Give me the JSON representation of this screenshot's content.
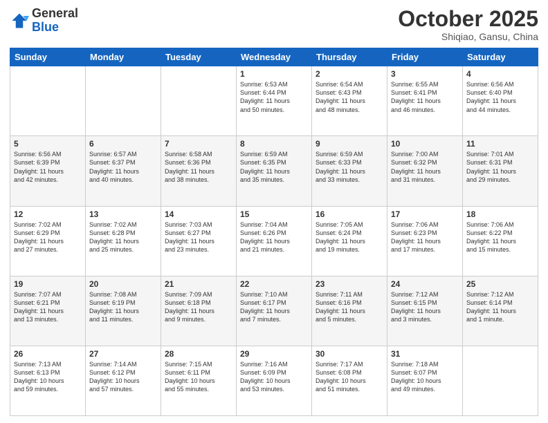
{
  "header": {
    "logo_general": "General",
    "logo_blue": "Blue",
    "month": "October 2025",
    "location": "Shiqiao, Gansu, China"
  },
  "weekdays": [
    "Sunday",
    "Monday",
    "Tuesday",
    "Wednesday",
    "Thursday",
    "Friday",
    "Saturday"
  ],
  "weeks": [
    [
      {
        "day": "",
        "info": ""
      },
      {
        "day": "",
        "info": ""
      },
      {
        "day": "",
        "info": ""
      },
      {
        "day": "1",
        "info": "Sunrise: 6:53 AM\nSunset: 6:44 PM\nDaylight: 11 hours\nand 50 minutes."
      },
      {
        "day": "2",
        "info": "Sunrise: 6:54 AM\nSunset: 6:43 PM\nDaylight: 11 hours\nand 48 minutes."
      },
      {
        "day": "3",
        "info": "Sunrise: 6:55 AM\nSunset: 6:41 PM\nDaylight: 11 hours\nand 46 minutes."
      },
      {
        "day": "4",
        "info": "Sunrise: 6:56 AM\nSunset: 6:40 PM\nDaylight: 11 hours\nand 44 minutes."
      }
    ],
    [
      {
        "day": "5",
        "info": "Sunrise: 6:56 AM\nSunset: 6:39 PM\nDaylight: 11 hours\nand 42 minutes."
      },
      {
        "day": "6",
        "info": "Sunrise: 6:57 AM\nSunset: 6:37 PM\nDaylight: 11 hours\nand 40 minutes."
      },
      {
        "day": "7",
        "info": "Sunrise: 6:58 AM\nSunset: 6:36 PM\nDaylight: 11 hours\nand 38 minutes."
      },
      {
        "day": "8",
        "info": "Sunrise: 6:59 AM\nSunset: 6:35 PM\nDaylight: 11 hours\nand 35 minutes."
      },
      {
        "day": "9",
        "info": "Sunrise: 6:59 AM\nSunset: 6:33 PM\nDaylight: 11 hours\nand 33 minutes."
      },
      {
        "day": "10",
        "info": "Sunrise: 7:00 AM\nSunset: 6:32 PM\nDaylight: 11 hours\nand 31 minutes."
      },
      {
        "day": "11",
        "info": "Sunrise: 7:01 AM\nSunset: 6:31 PM\nDaylight: 11 hours\nand 29 minutes."
      }
    ],
    [
      {
        "day": "12",
        "info": "Sunrise: 7:02 AM\nSunset: 6:29 PM\nDaylight: 11 hours\nand 27 minutes."
      },
      {
        "day": "13",
        "info": "Sunrise: 7:02 AM\nSunset: 6:28 PM\nDaylight: 11 hours\nand 25 minutes."
      },
      {
        "day": "14",
        "info": "Sunrise: 7:03 AM\nSunset: 6:27 PM\nDaylight: 11 hours\nand 23 minutes."
      },
      {
        "day": "15",
        "info": "Sunrise: 7:04 AM\nSunset: 6:26 PM\nDaylight: 11 hours\nand 21 minutes."
      },
      {
        "day": "16",
        "info": "Sunrise: 7:05 AM\nSunset: 6:24 PM\nDaylight: 11 hours\nand 19 minutes."
      },
      {
        "day": "17",
        "info": "Sunrise: 7:06 AM\nSunset: 6:23 PM\nDaylight: 11 hours\nand 17 minutes."
      },
      {
        "day": "18",
        "info": "Sunrise: 7:06 AM\nSunset: 6:22 PM\nDaylight: 11 hours\nand 15 minutes."
      }
    ],
    [
      {
        "day": "19",
        "info": "Sunrise: 7:07 AM\nSunset: 6:21 PM\nDaylight: 11 hours\nand 13 minutes."
      },
      {
        "day": "20",
        "info": "Sunrise: 7:08 AM\nSunset: 6:19 PM\nDaylight: 11 hours\nand 11 minutes."
      },
      {
        "day": "21",
        "info": "Sunrise: 7:09 AM\nSunset: 6:18 PM\nDaylight: 11 hours\nand 9 minutes."
      },
      {
        "day": "22",
        "info": "Sunrise: 7:10 AM\nSunset: 6:17 PM\nDaylight: 11 hours\nand 7 minutes."
      },
      {
        "day": "23",
        "info": "Sunrise: 7:11 AM\nSunset: 6:16 PM\nDaylight: 11 hours\nand 5 minutes."
      },
      {
        "day": "24",
        "info": "Sunrise: 7:12 AM\nSunset: 6:15 PM\nDaylight: 11 hours\nand 3 minutes."
      },
      {
        "day": "25",
        "info": "Sunrise: 7:12 AM\nSunset: 6:14 PM\nDaylight: 11 hours\nand 1 minute."
      }
    ],
    [
      {
        "day": "26",
        "info": "Sunrise: 7:13 AM\nSunset: 6:13 PM\nDaylight: 10 hours\nand 59 minutes."
      },
      {
        "day": "27",
        "info": "Sunrise: 7:14 AM\nSunset: 6:12 PM\nDaylight: 10 hours\nand 57 minutes."
      },
      {
        "day": "28",
        "info": "Sunrise: 7:15 AM\nSunset: 6:11 PM\nDaylight: 10 hours\nand 55 minutes."
      },
      {
        "day": "29",
        "info": "Sunrise: 7:16 AM\nSunset: 6:09 PM\nDaylight: 10 hours\nand 53 minutes."
      },
      {
        "day": "30",
        "info": "Sunrise: 7:17 AM\nSunset: 6:08 PM\nDaylight: 10 hours\nand 51 minutes."
      },
      {
        "day": "31",
        "info": "Sunrise: 7:18 AM\nSunset: 6:07 PM\nDaylight: 10 hours\nand 49 minutes."
      },
      {
        "day": "",
        "info": ""
      }
    ]
  ]
}
